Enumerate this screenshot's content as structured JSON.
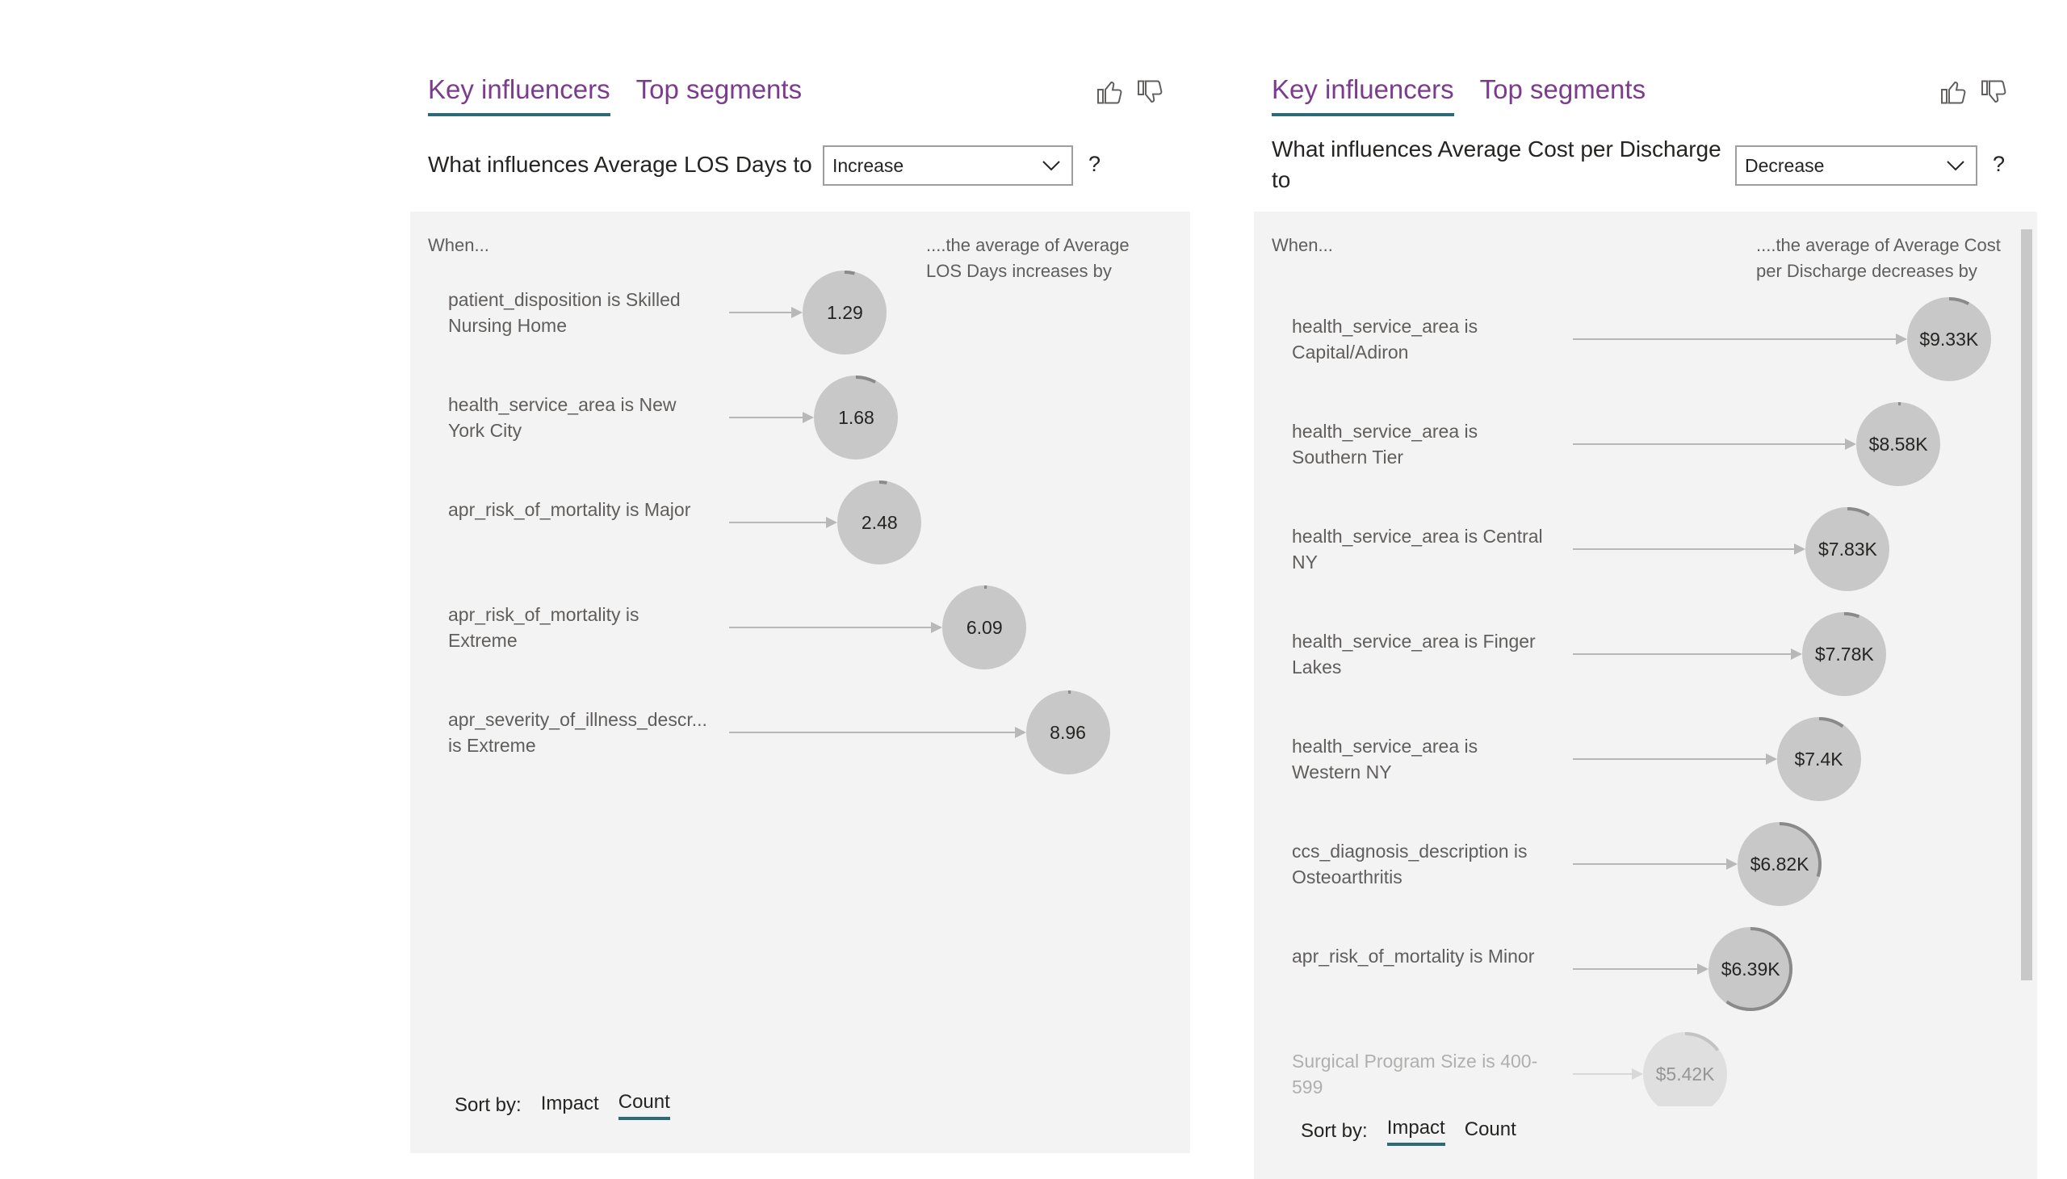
{
  "visuals": [
    {
      "tabs": [
        {
          "label": "Key influencers",
          "active": true
        },
        {
          "label": "Top segments",
          "active": false
        }
      ],
      "feedback": {
        "like_icon": "thumbs-up-icon",
        "dislike_icon": "thumbs-down-icon"
      },
      "question": "What influences Average LOS Days to",
      "dropdown": {
        "selected": "Increase"
      },
      "help": "?",
      "col_when": "When...",
      "col_result": "....the average of Average LOS Days increases by",
      "influencers": [
        {
          "label": "patient_disposition is Skilled Nursing Home",
          "value": 1.29,
          "value_label": "1.29",
          "progress": 0.04
        },
        {
          "label": "health_service_area is New York City",
          "value": 1.68,
          "value_label": "1.68",
          "progress": 0.08
        },
        {
          "label": "apr_risk_of_mortality is Major",
          "value": 2.48,
          "value_label": "2.48",
          "progress": 0.03
        },
        {
          "label": "apr_risk_of_mortality is Extreme",
          "value": 6.09,
          "value_label": "6.09",
          "progress": 0.01
        },
        {
          "label": "apr_severity_of_illness_descr... is Extreme",
          "value": 8.96,
          "value_label": "8.96",
          "progress": 0.01
        }
      ],
      "sort": {
        "label": "Sort by:",
        "options": [
          {
            "label": "Impact",
            "active": false
          },
          {
            "label": "Count",
            "active": true
          }
        ]
      }
    },
    {
      "tabs": [
        {
          "label": "Key influencers",
          "active": true
        },
        {
          "label": "Top segments",
          "active": false
        }
      ],
      "feedback": {
        "like_icon": "thumbs-up-icon",
        "dislike_icon": "thumbs-down-icon"
      },
      "question_line1": "What influences Average Cost per Discharge",
      "question_line2": "to",
      "dropdown": {
        "selected": "Decrease"
      },
      "help": "?",
      "col_when": "When...",
      "col_result": "....the average of Average Cost per Discharge decreases by",
      "influencers": [
        {
          "label": "health_service_area is Capital/Adiron",
          "value": 9.33,
          "value_label": "$9.33K",
          "progress": 0.08
        },
        {
          "label": "health_service_area is Southern Tier",
          "value": 8.58,
          "value_label": "$8.58K",
          "progress": 0.01
        },
        {
          "label": "health_service_area is Central NY",
          "value": 7.83,
          "value_label": "$7.83K",
          "progress": 0.09
        },
        {
          "label": "health_service_area is Finger Lakes",
          "value": 7.78,
          "value_label": "$7.78K",
          "progress": 0.06
        },
        {
          "label": "health_service_area is Western NY",
          "value": 7.4,
          "value_label": "$7.4K",
          "progress": 0.1
        },
        {
          "label": "ccs_diagnosis_description is Osteoarthritis",
          "value": 6.82,
          "value_label": "$6.82K",
          "progress": 0.3
        },
        {
          "label": "apr_risk_of_mortality is Minor",
          "value": 6.39,
          "value_label": "$6.39K",
          "progress": 0.6
        },
        {
          "label": "Surgical Program Size is 400-599",
          "value": 5.42,
          "value_label": "$5.42K",
          "progress": 0.15
        }
      ],
      "sort": {
        "label": "Sort by:",
        "options": [
          {
            "label": "Impact",
            "active": true
          },
          {
            "label": "Count",
            "active": false
          }
        ]
      }
    }
  ]
}
